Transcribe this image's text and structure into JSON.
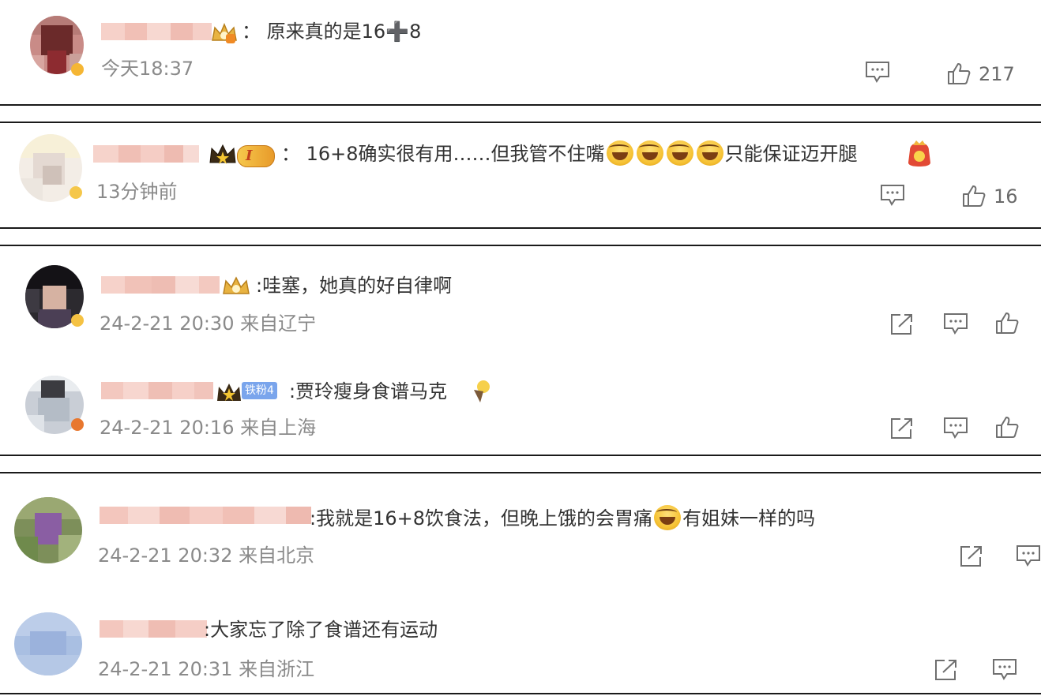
{
  "comments": [
    {
      "text": "：  原来真的是16",
      "text_after_plus": "8",
      "plus_glyph": "➕",
      "time": "今天18:37",
      "likes": "217",
      "icons": [
        "comment-icon",
        "like-icon"
      ]
    },
    {
      "text_part1": "：  16+8确实很有用……但我管不住嘴",
      "text_part2": "只能保证迈开腿",
      "laugh_emoji_count": 4,
      "time": "13分钟前",
      "likes": "16",
      "rank_badge": "I",
      "icons": [
        "comment-icon",
        "like-icon"
      ]
    },
    {
      "text": ":哇塞，她真的好自律啊",
      "time": "24-2-21 20:30 来自辽宁",
      "icons": [
        "share-icon",
        "comment-icon",
        "like-icon"
      ]
    },
    {
      "text": ":贾玲瘦身食谱马克",
      "fan_badge": "铁粉4",
      "time": "24-2-21 20:16 来自上海",
      "icons": [
        "share-icon",
        "comment-icon",
        "like-icon"
      ]
    },
    {
      "text_part1": ":我就是16+8饮食法，但晚上饿的会胃痛",
      "text_part2": "有姐妹一样的吗",
      "time": "24-2-21 20:32 来自北京",
      "icons": [
        "share-icon",
        "comment-icon"
      ]
    },
    {
      "text": ":大家忘了除了食谱还有运动",
      "time": "24-2-21 20:31 来自浙江",
      "icons": [
        "share-icon",
        "comment-icon"
      ]
    }
  ],
  "colors": {
    "text": "#333333",
    "meta": "#8a8a8a",
    "icon": "#6f6f6f",
    "divider": "#1a1a1a",
    "name_blur": "#f3c6bd",
    "fan_badge": "#7aa5ec",
    "crown": "#e8b341"
  }
}
